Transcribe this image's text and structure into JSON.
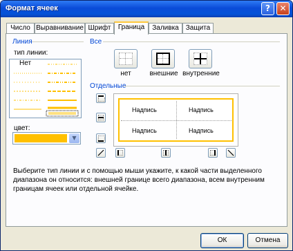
{
  "window": {
    "title": "Формат ячеек"
  },
  "tabs": [
    "Число",
    "Выравнивание",
    "Шрифт",
    "Граница",
    "Заливка",
    "Защита"
  ],
  "line_group": {
    "title": "Линия",
    "style_label": "тип линии:",
    "none_label": "Нет",
    "color_label": "цвет:",
    "color_value": "#ffc000"
  },
  "presets_group": {
    "title": "Все",
    "buttons": [
      "нет",
      "внешние",
      "внутренние"
    ]
  },
  "borders_group": {
    "title": "Отдельные",
    "preview_text": "Надпись"
  },
  "description": "Выберите тип линии и с помощью мыши укажите, к какой части выделенного диапазона он относится: внешней границе всего диапазона, всем внутренним границам ячеек или отдельной ячейке.",
  "buttons": {
    "ok": "ОК",
    "cancel": "Отмена"
  }
}
